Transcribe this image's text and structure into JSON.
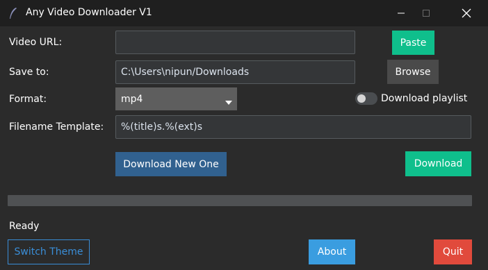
{
  "window": {
    "title": "Any Video Downloader V1",
    "icons": [
      "feather-icon",
      "minimize-icon",
      "maximize-icon",
      "close-icon"
    ]
  },
  "form": {
    "video_url": {
      "label": "Video URL:",
      "value": ""
    },
    "paste_button": "Paste",
    "save_to": {
      "label": "Save to:",
      "value": "C:\\Users\\nipun/Downloads"
    },
    "browse_button": "Browse",
    "format": {
      "label": "Format:",
      "selected": "mp4"
    },
    "playlist_toggle": {
      "label": "Download playlist",
      "checked": false
    },
    "filename_template": {
      "label": "Filename Template:",
      "value": "%(title)s.%(ext)s"
    },
    "download_new_button": "Download New One",
    "download_button": "Download"
  },
  "progress": {
    "value": 0
  },
  "status": {
    "text": "Ready"
  },
  "footer": {
    "switch_theme_button": "Switch Theme",
    "about_button": "About",
    "quit_button": "Quit"
  },
  "colors": {
    "background": "#2b2b2b",
    "titlebar": "#1f1f1f",
    "green": "#0fbf8c",
    "blue": "#31618f",
    "about_blue": "#3a9de0",
    "quit_red": "#e14a3c"
  }
}
